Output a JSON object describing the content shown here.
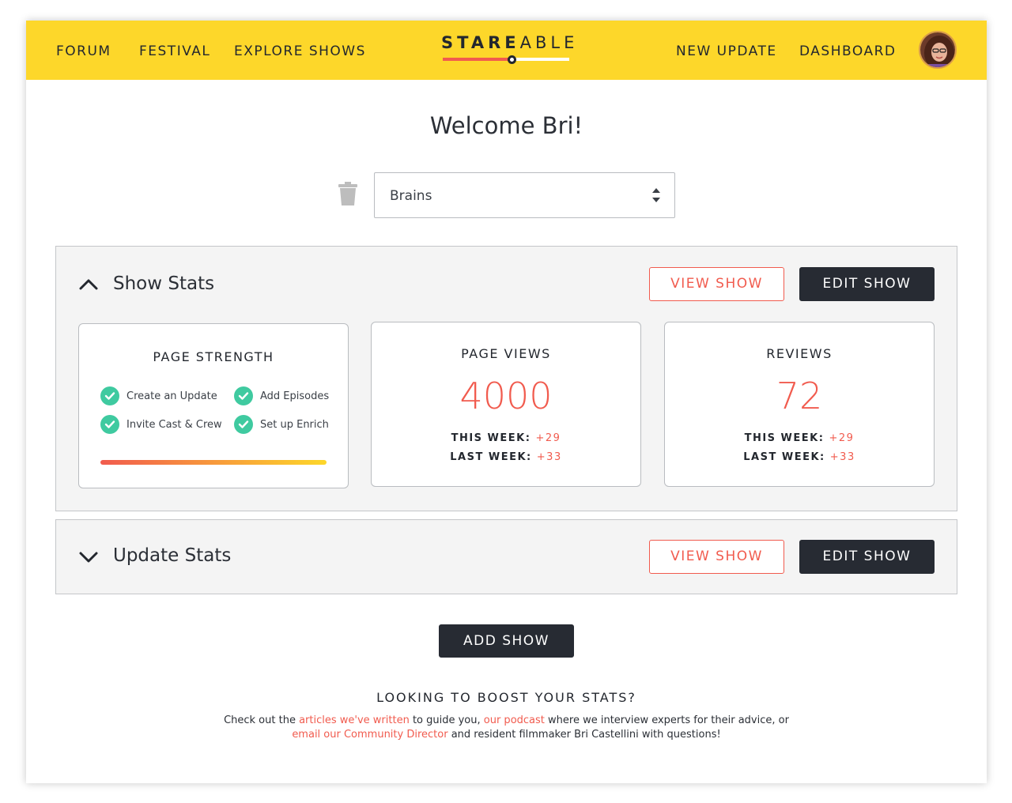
{
  "nav": {
    "left_links": [
      "FORUM",
      "FESTIVAL",
      "EXPLORE SHOWS"
    ],
    "right_links": [
      "NEW UPDATE",
      "DASHBOARD"
    ],
    "logo_bold": "STARE",
    "logo_thin": "ABLE"
  },
  "welcome": "Welcome Bri!",
  "show_select": {
    "value": "Brains"
  },
  "show_stats": {
    "title": "Show Stats",
    "view_label": "VIEW SHOW",
    "edit_label": "EDIT SHOW",
    "page_strength": {
      "title": "PAGE STRENGTH",
      "items": [
        "Create an Update",
        "Add Episodes",
        "Invite Cast & Crew",
        "Set up Enrich"
      ],
      "progress": 1.0
    },
    "page_views": {
      "title": "PAGE VIEWS",
      "value": "4000",
      "this_week_label": "THIS WEEK:",
      "this_week": "+29",
      "last_week_label": "LAST WEEK:",
      "last_week": "+33"
    },
    "reviews": {
      "title": "REVIEWS",
      "value": "72",
      "this_week_label": "THIS WEEK:",
      "this_week": "+29",
      "last_week_label": "LAST WEEK:",
      "last_week": "+33"
    }
  },
  "update_stats": {
    "title": "Update Stats",
    "view_label": "VIEW SHOW",
    "edit_label": "EDIT SHOW"
  },
  "add_show_label": "ADD SHOW",
  "boost": {
    "title": "LOOKING TO BOOST YOUR STATS?",
    "t1": "Check out the ",
    "link1": "articles we've written",
    "t2": " to guide you, ",
    "link2": "our podcast",
    "t3": " where we interview experts for their advice, or ",
    "link3": "email our Community Director",
    "t4": " and resident filmmaker Bri Castellini with questions!"
  },
  "colors": {
    "nav_bg": "#fdd72a",
    "accent": "#f15b4e",
    "dark": "#272b33",
    "check": "#3fcaa0"
  }
}
